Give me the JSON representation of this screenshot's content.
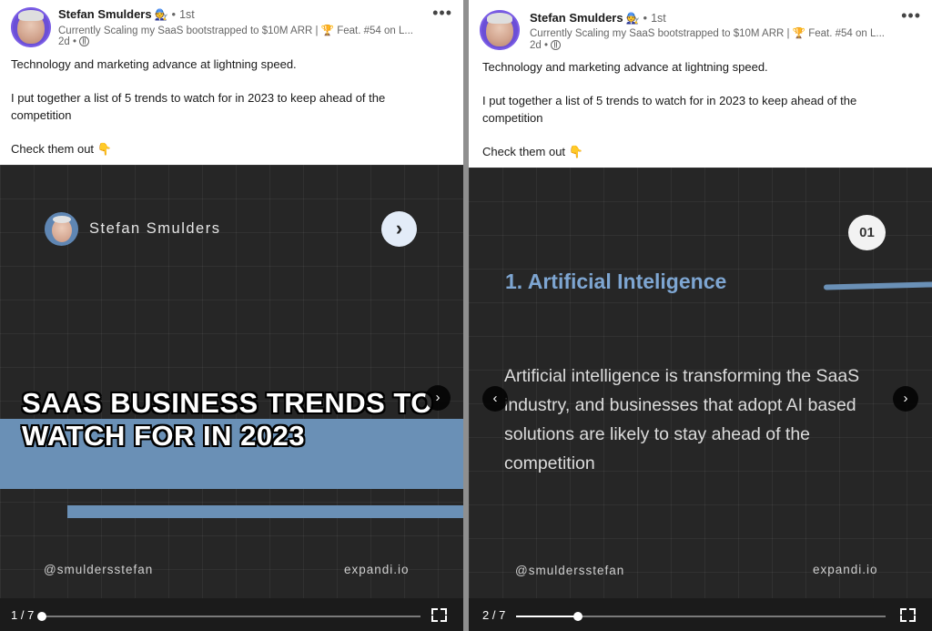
{
  "posts": [
    {
      "author_name": "Stefan Smulders",
      "author_emoji": "🧑‍🔧",
      "connection": "1st",
      "headline": "Currently Scaling my SaaS bootstrapped to $10M ARR | 🏆 Feat. #54 on L...",
      "time": "2d",
      "more_label": "•••",
      "text_line1": "Technology and marketing advance at lightning speed.",
      "text_line2": "I put together a list of 5 trends to watch for in 2023 to keep ahead of the competition",
      "text_line3": "Check them out 👇",
      "slide": {
        "author_name": "Stefan Smulders",
        "next_glyph": "›",
        "title_line1": "SAAS BUSINESS TRENDS TO",
        "title_line2": "WATCH FOR IN 2023",
        "arrow_next": "›",
        "footer_handle": "@smuldersstefan",
        "footer_site": "expandi.io"
      },
      "page_counter": "1 / 7",
      "progress": 0.0
    },
    {
      "author_name": "Stefan Smulders",
      "author_emoji": "🧑‍🔧",
      "connection": "1st",
      "headline": "Currently Scaling my SaaS bootstrapped to $10M ARR | 🏆 Feat. #54 on L...",
      "time": "2d",
      "more_label": "•••",
      "text_line1": "Technology and marketing advance at lightning speed.",
      "text_line2": "I put together a list of 5 trends to watch for in 2023 to keep ahead of the competition",
      "text_line3": "Check them out 👇",
      "slide": {
        "number": "01",
        "heading": "1. Artificial Inteligence",
        "body": "Artificial intelligence is transforming the SaaS industry, and businesses that adopt AI  based solutions are likely to stay ahead of the competition",
        "arrow_prev": "‹",
        "arrow_next": "›",
        "footer_handle": "@smuldersstefan",
        "footer_site": "expandi.io"
      },
      "page_counter": "2 / 7",
      "progress": 0.167
    }
  ],
  "icons": {
    "avatar": "avatar-icon",
    "globe": "globe-icon",
    "more": "more-icon",
    "fullscreen": "fullscreen-icon"
  },
  "colors": {
    "accent_blue": "#6a90b6",
    "slide_bg": "#262626",
    "heading_blue": "#7ea6d2"
  }
}
